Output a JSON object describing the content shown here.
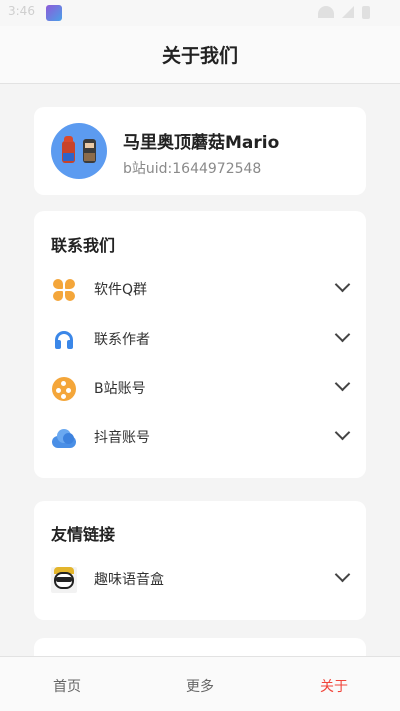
{
  "status_bar": {
    "time": "3:46"
  },
  "header": {
    "title": "关于我们"
  },
  "profile": {
    "name": "马里奥顶蘑菇Mario",
    "uid": "b站uid:1644972548"
  },
  "contact": {
    "title": "联系我们",
    "items": [
      {
        "label": "软件Q群",
        "icon": "clover-icon"
      },
      {
        "label": "联系作者",
        "icon": "headset-icon"
      },
      {
        "label": "B站账号",
        "icon": "bilibili-icon"
      },
      {
        "label": "抖音账号",
        "icon": "cloud-icon"
      }
    ]
  },
  "links": {
    "title": "友情链接",
    "items": [
      {
        "label": "趣味语音盒",
        "icon": "panda-icon"
      }
    ]
  },
  "bottom_nav": {
    "home": "首页",
    "more": "更多",
    "about": "关于",
    "active_color": "#f0443a"
  },
  "colors": {
    "icon_orange": "#f4a63a",
    "icon_blue": "#3b87e8",
    "avatar_bg": "#5c9bf0"
  }
}
